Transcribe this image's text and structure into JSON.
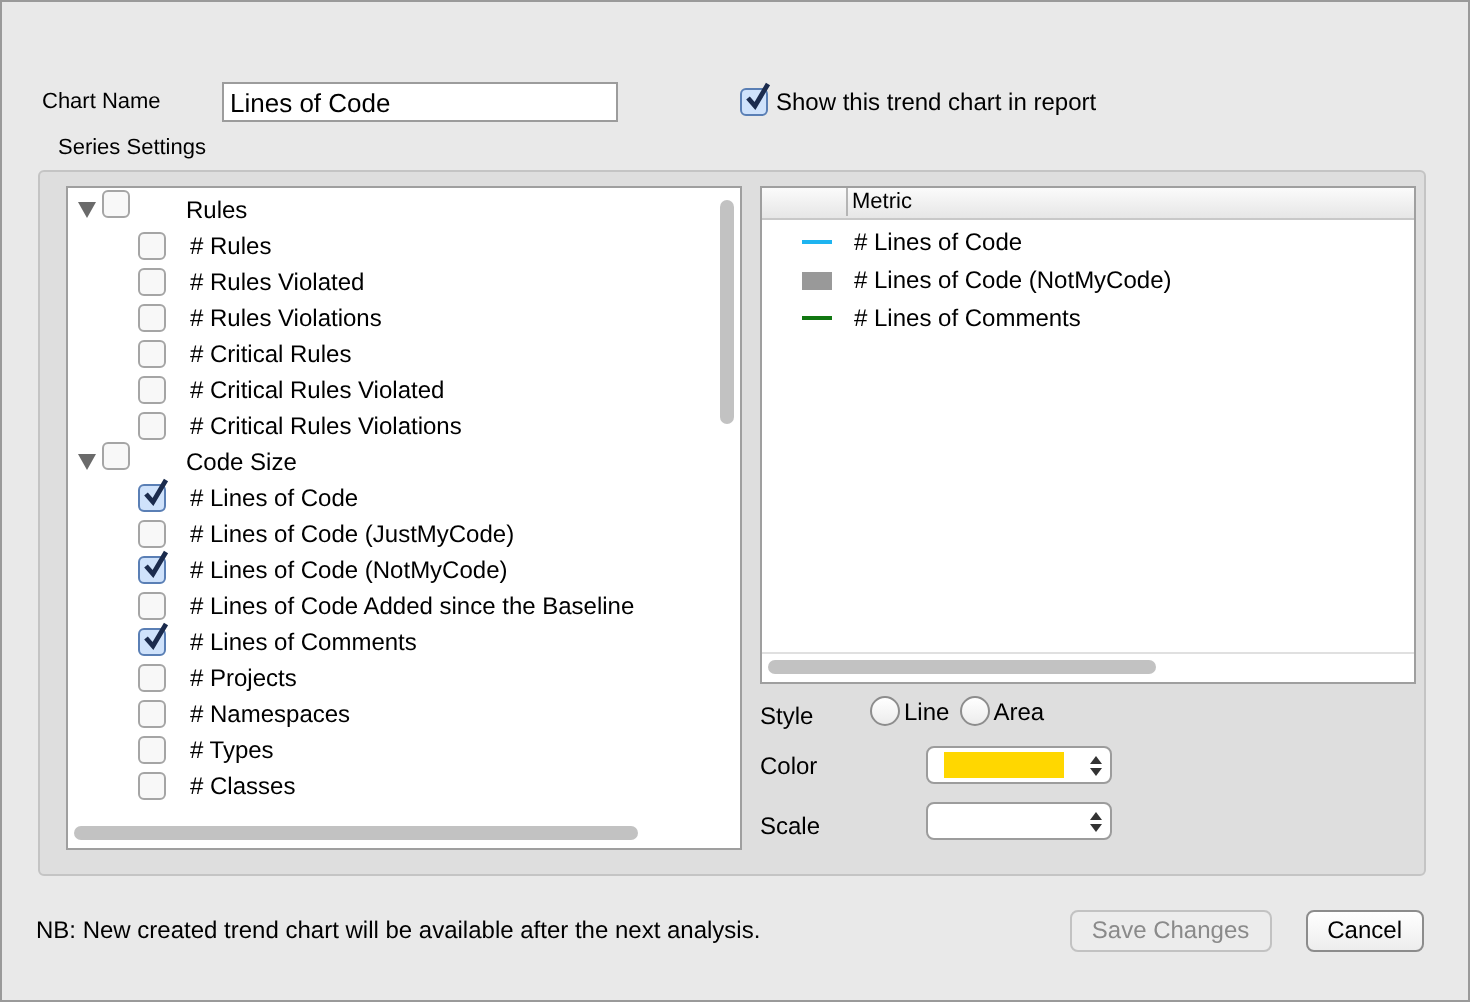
{
  "chart_name": {
    "label": "Chart Name",
    "value": "Lines of Code"
  },
  "show_in_report": {
    "label": "Show this trend chart in report",
    "checked": true
  },
  "series_settings": {
    "title": "Series Settings",
    "tree": [
      {
        "label": "Rules",
        "expanded": true,
        "checked": false,
        "children": [
          {
            "label": "# Rules",
            "checked": false
          },
          {
            "label": "# Rules Violated",
            "checked": false
          },
          {
            "label": "# Rules Violations",
            "checked": false
          },
          {
            "label": "# Critical Rules",
            "checked": false
          },
          {
            "label": "# Critical Rules Violated",
            "checked": false
          },
          {
            "label": "# Critical Rules Violations",
            "checked": false
          }
        ]
      },
      {
        "label": "Code Size",
        "expanded": true,
        "checked": false,
        "children": [
          {
            "label": "# Lines of Code",
            "checked": true
          },
          {
            "label": "# Lines of Code (JustMyCode)",
            "checked": false
          },
          {
            "label": "# Lines of Code (NotMyCode)",
            "checked": true
          },
          {
            "label": "# Lines of Code Added since the Baseline",
            "checked": false
          },
          {
            "label": "# Lines of Comments",
            "checked": true
          },
          {
            "label": "# Projects",
            "checked": false
          },
          {
            "label": "# Namespaces",
            "checked": false
          },
          {
            "label": "# Types",
            "checked": false
          },
          {
            "label": "# Classes",
            "checked": false
          }
        ]
      }
    ],
    "metric_table": {
      "column": "Metric",
      "rows": [
        {
          "kind": "line",
          "color": "#1eb4f0",
          "label": "# Lines of Code"
        },
        {
          "kind": "area",
          "color": "#999999",
          "label": "# Lines of Code (NotMyCode)"
        },
        {
          "kind": "line",
          "color": "#117711",
          "label": "# Lines of Comments"
        }
      ]
    },
    "style": {
      "label": "Style",
      "options": [
        {
          "label": "Line",
          "selected": false
        },
        {
          "label": "Area",
          "selected": false
        }
      ]
    },
    "color": {
      "label": "Color",
      "color": "#ffd700"
    },
    "scale": {
      "label": "Scale"
    }
  },
  "note": "NB: New created trend chart will be available after the next analysis.",
  "buttons": [
    {
      "label": "Save Changes",
      "disabled": true
    },
    {
      "label": "Cancel",
      "disabled": false
    }
  ]
}
